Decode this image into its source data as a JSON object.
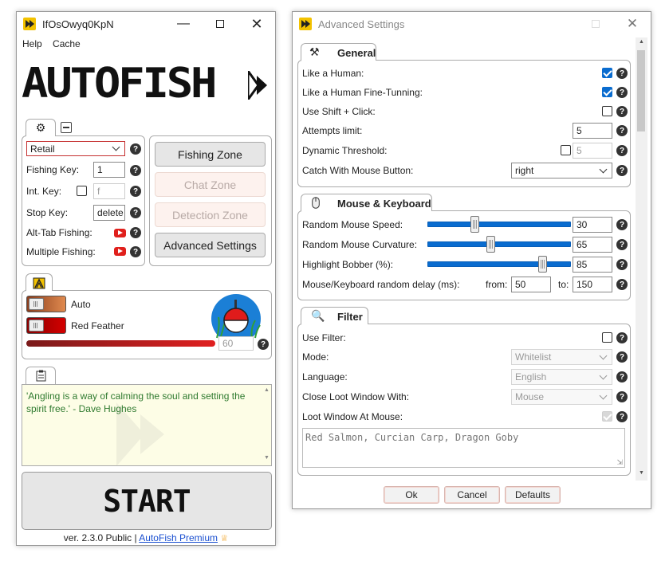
{
  "main_window": {
    "title": "IfOsOwyq0KpN",
    "menu": [
      "Help",
      "Cache"
    ],
    "logo_text": "AUTOFISH",
    "settings_tab": {
      "preset_select": "Retail",
      "fishing_key_label": "Fishing Key:",
      "fishing_key_value": "1",
      "int_key_label": "Int. Key:",
      "int_key_value": "f",
      "stop_key_label": "Stop Key:",
      "stop_key_value": "delete",
      "alt_tab_label": "Alt-Tab Fishing:",
      "multiple_label": "Multiple Fishing:"
    },
    "buttons": {
      "fishing_zone": "Fishing Zone",
      "chat_zone": "Chat Zone",
      "detection_zone": "Detection Zone",
      "advanced_settings": "Advanced Settings"
    },
    "lure": {
      "auto_label": "Auto",
      "red_feather_label": "Red Feather",
      "progress_value": "60"
    },
    "notes": {
      "quote": "'Angling is a way of calming the soul and setting the spirit free.' - Dave Hughes"
    },
    "start_label": "START",
    "footer": {
      "version": "ver. 2.3.0 Public |",
      "premium_link": "AutoFish Premium"
    }
  },
  "advanced_window": {
    "title": "Advanced Settings",
    "general": {
      "title": "General",
      "like_human": "Like a Human:",
      "like_human_checked": true,
      "fine_tuning": "Like a Human Fine-Tunning:",
      "fine_tuning_checked": true,
      "shift_click": "Use Shift + Click:",
      "shift_click_checked": false,
      "attempts_label": "Attempts limit:",
      "attempts_value": "5",
      "dynamic_label": "Dynamic Threshold:",
      "dynamic_value": "5",
      "catch_label": "Catch With Mouse Button:",
      "catch_value": "right"
    },
    "mouse_keyboard": {
      "title": "Mouse & Keyboard",
      "speed_label": "Random Mouse Speed:",
      "speed_value": "30",
      "speed_fraction": 0.32,
      "curvature_label": "Random Mouse Curvature:",
      "curvature_value": "65",
      "curvature_fraction": 0.44,
      "highlight_label": "Highlight Bobber (%):",
      "highlight_value": "85",
      "highlight_fraction": 0.82,
      "delay_label": "Mouse/Keyboard random delay (ms):",
      "from_label": "from:",
      "from_value": "50",
      "to_label": "to:",
      "to_value": "150"
    },
    "filter": {
      "title": "Filter",
      "use_filter": "Use Filter:",
      "mode_label": "Mode:",
      "mode_value": "Whitelist",
      "language_label": "Language:",
      "language_value": "English",
      "close_label": "Close Loot Window With:",
      "close_value": "Mouse",
      "loot_label": "Loot Window At Mouse:",
      "loot_text": "Red Salmon, Curcian Carp, Dragon Goby"
    },
    "dialog_buttons": {
      "ok": "Ok",
      "cancel": "Cancel",
      "defaults": "Defaults"
    }
  }
}
